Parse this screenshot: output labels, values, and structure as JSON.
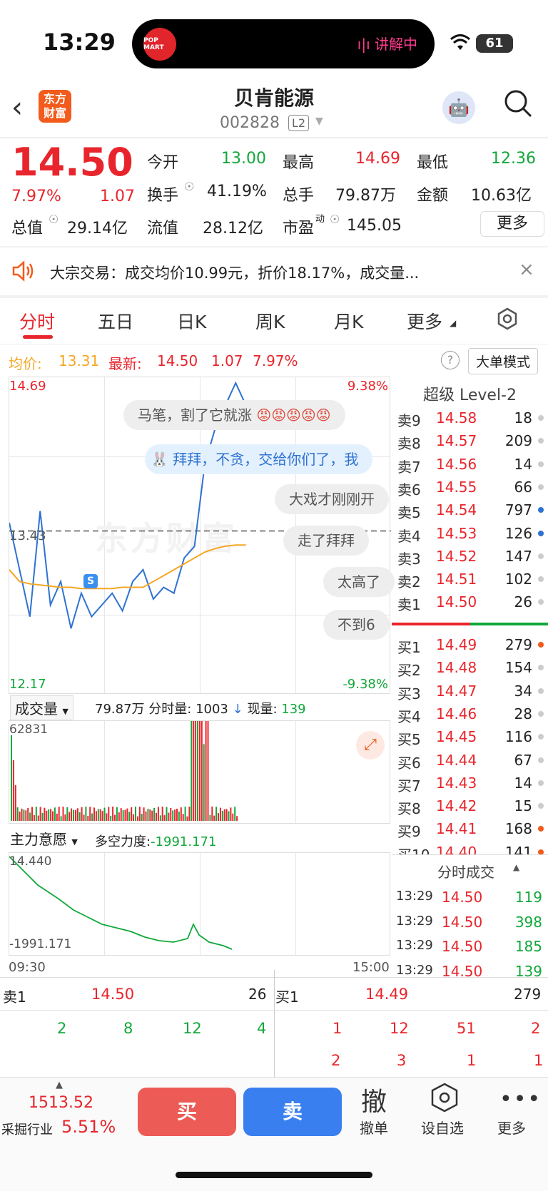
{
  "status": {
    "time": "13:29",
    "island_logo": "POP MART",
    "island_live": "ı|ı 讲解中",
    "battery": "61"
  },
  "header": {
    "app_logo": "东方财富",
    "title": "贝肯能源",
    "code": "002828",
    "level": "L2"
  },
  "quote": {
    "price": "14.50",
    "change_pct": "7.97%",
    "change": "1.07",
    "open_label": "今开",
    "open": "13.00",
    "high_label": "最高",
    "high": "14.69",
    "low_label": "最低",
    "low": "12.36",
    "turnover_label": "换手",
    "turnover": "41.19%",
    "volume_label": "总手",
    "volume": "79.87万",
    "amount_label": "金额",
    "amount": "10.63亿",
    "total_mv_label": "总值",
    "total_mv": "29.14亿",
    "float_mv_label": "流值",
    "float_mv": "28.12亿",
    "pe_label": "市盈",
    "pe_sup": "动",
    "pe": "145.05",
    "more_button": "更多"
  },
  "notice": {
    "text": "大宗交易：成交均价10.99元，折价18.17%，成交量..."
  },
  "tabs": [
    "分时",
    "五日",
    "日K",
    "周K",
    "月K",
    "更多"
  ],
  "info_bar": {
    "avg_label": "均价:",
    "avg": "13.31",
    "latest_label": "最新:",
    "latest": "14.50",
    "change": "1.07",
    "pct": "7.97%",
    "mode_button": "大单模式"
  },
  "chart": {
    "top_price": "14.69",
    "top_pct": "9.38%",
    "ref_price": "13.43",
    "bottom_price": "12.17",
    "bottom_pct": "-9.38%",
    "s_marker": "S",
    "watermark": "东方财富",
    "bubbles": [
      "马笔，割了它就涨",
      "拜拜，不贪，交给你们了，我",
      "大戏才刚刚开",
      "走了拜拜",
      "太高了",
      "不到6"
    ],
    "volume_selector": "成交量",
    "volume_total": "79.87万",
    "time_vol_label": "分时量:",
    "time_vol": "1003",
    "cur_vol_label": "现量:",
    "cur_vol": "139",
    "volume_max": "62831",
    "ind_selector": "主力意愿",
    "ind_label": "多空力度:",
    "ind_value": "-1991.171",
    "ind_top": "14.440",
    "ind_bottom": "-1991.171",
    "time_start": "09:30",
    "time_end": "15:00"
  },
  "chart_data": {
    "type": "line",
    "series": [
      {
        "name": "最新",
        "values": [
          13.5,
          13.1,
          12.7,
          13.6,
          12.8,
          13.0,
          12.6,
          12.9,
          12.7,
          12.8,
          12.9,
          12.75,
          13.0,
          13.1,
          12.85,
          12.95,
          12.9,
          13.2,
          13.3,
          14.0,
          14.3,
          14.5,
          14.69,
          14.5
        ]
      },
      {
        "name": "均价",
        "values": [
          13.1,
          13.0,
          12.98,
          12.97,
          12.96,
          12.95,
          12.95,
          12.94,
          12.94,
          12.94,
          12.94,
          12.95,
          12.95,
          12.95,
          13.0,
          13.05,
          13.1,
          13.15,
          13.2,
          13.25,
          13.28,
          13.3,
          13.31,
          13.31
        ]
      }
    ],
    "ylim": [
      12.17,
      14.69
    ]
  },
  "book": {
    "title": "超级 Level-2",
    "asks": [
      {
        "label": "卖9",
        "price": "14.58",
        "vol": "18"
      },
      {
        "label": "卖8",
        "price": "14.57",
        "vol": "209"
      },
      {
        "label": "卖7",
        "price": "14.56",
        "vol": "14"
      },
      {
        "label": "卖6",
        "price": "14.55",
        "vol": "66"
      },
      {
        "label": "卖5",
        "price": "14.54",
        "vol": "797"
      },
      {
        "label": "卖4",
        "price": "14.53",
        "vol": "126"
      },
      {
        "label": "卖3",
        "price": "14.52",
        "vol": "147"
      },
      {
        "label": "卖2",
        "price": "14.51",
        "vol": "102"
      },
      {
        "label": "卖1",
        "price": "14.50",
        "vol": "26"
      }
    ],
    "bids": [
      {
        "label": "买1",
        "price": "14.49",
        "vol": "279"
      },
      {
        "label": "买2",
        "price": "14.48",
        "vol": "154"
      },
      {
        "label": "买3",
        "price": "14.47",
        "vol": "34"
      },
      {
        "label": "买4",
        "price": "14.46",
        "vol": "28"
      },
      {
        "label": "买5",
        "price": "14.45",
        "vol": "116"
      },
      {
        "label": "买6",
        "price": "14.44",
        "vol": "67"
      },
      {
        "label": "买7",
        "price": "14.43",
        "vol": "14"
      },
      {
        "label": "买8",
        "price": "14.42",
        "vol": "15"
      },
      {
        "label": "买9",
        "price": "14.41",
        "vol": "168"
      },
      {
        "label": "买10",
        "price": "14.40",
        "vol": "141"
      }
    ],
    "ticks_title": "分时成交",
    "ticks": [
      {
        "time": "13:29",
        "price": "14.50",
        "vol": "119"
      },
      {
        "time": "13:29",
        "price": "14.50",
        "vol": "398"
      },
      {
        "time": "13:29",
        "price": "14.50",
        "vol": "185"
      },
      {
        "time": "13:29",
        "price": "14.50",
        "vol": "139"
      }
    ]
  },
  "queue": {
    "sell_label": "卖1",
    "sell_price": "14.50",
    "sell_vol": "26",
    "buy_label": "买1",
    "buy_price": "14.49",
    "buy_vol": "279",
    "sell_orders": [
      "2",
      "8",
      "12",
      "4"
    ],
    "buy_orders_row1": [
      "1",
      "12",
      "51",
      "2"
    ],
    "buy_orders_row2": [
      "2",
      "3",
      "1",
      "1"
    ]
  },
  "bottom": {
    "index_value": "1513.52",
    "index_name": "采掘行业",
    "index_pct": "5.51%",
    "buy": "买",
    "sell": "卖",
    "cancel_icon_text": "撤",
    "cancel": "撤单",
    "watchlist": "设自选",
    "more": "更多"
  }
}
